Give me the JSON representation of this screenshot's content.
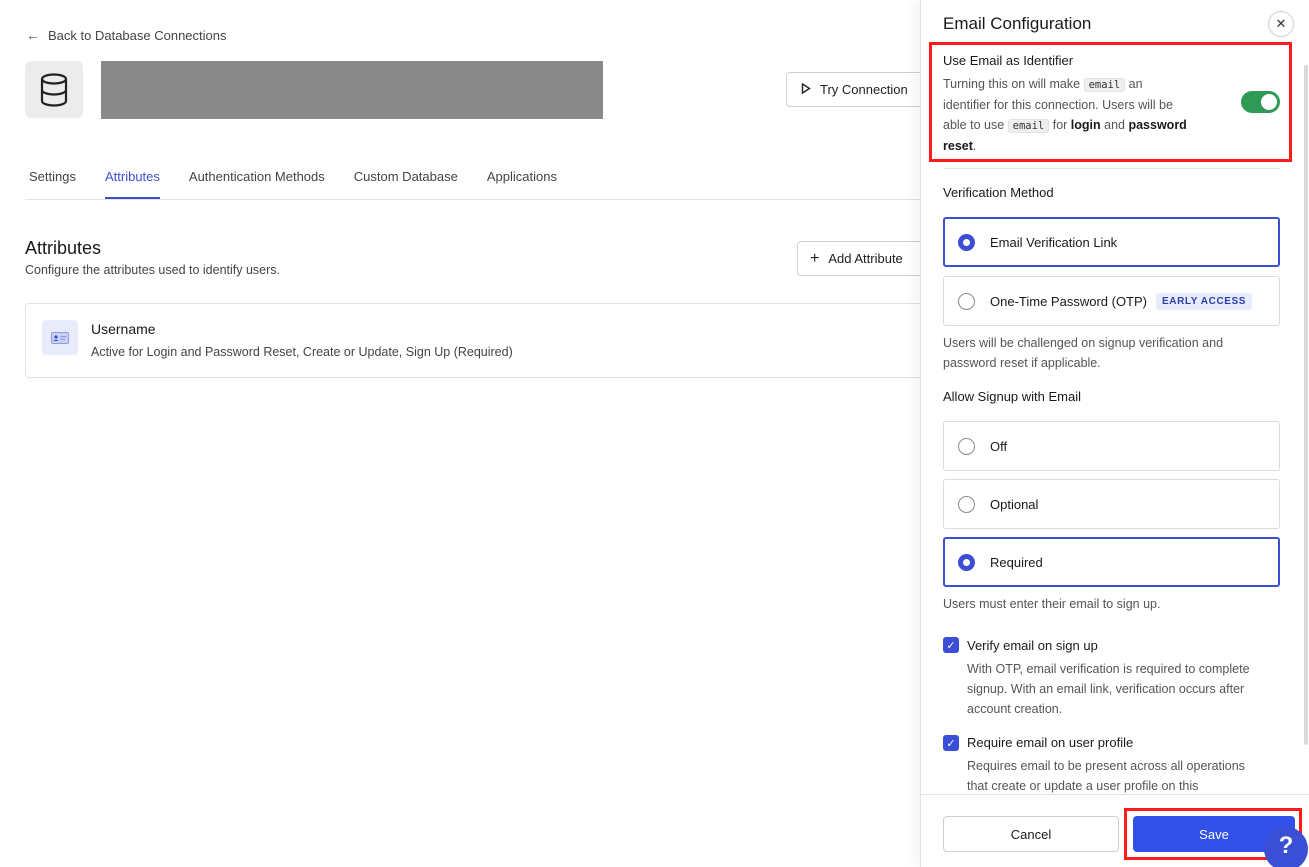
{
  "main": {
    "back_link": "Back to Database Connections",
    "try_connection": "Try Connection",
    "tabs": [
      {
        "label": "Settings"
      },
      {
        "label": "Attributes"
      },
      {
        "label": "Authentication Methods"
      },
      {
        "label": "Custom Database"
      },
      {
        "label": "Applications"
      }
    ],
    "active_tab": "Attributes",
    "attributes_title": "Attributes",
    "attributes_subtitle": "Configure the attributes used to identify users.",
    "add_attribute": "Add Attribute",
    "attribute_card": {
      "title": "Username",
      "description": "Active for Login and Password Reset, Create or Update, Sign Up (Required)"
    }
  },
  "panel": {
    "title": "Email Configuration",
    "close_icon": "close-icon",
    "email_identifier": {
      "title": "Use Email as Identifier",
      "desc_1": "Turning this on will make ",
      "code_1": "email",
      "desc_2": " an identifier for this connection. Users will be able to use ",
      "code_2": "email",
      "desc_3": " for ",
      "bold_1": "login",
      "desc_4": " and ",
      "bold_2": "password reset",
      "desc_5": ".",
      "enabled": true
    },
    "verification": {
      "label": "Verification Method",
      "options": [
        {
          "label": "Email Verification Link",
          "selected": true
        },
        {
          "label": "One-Time Password (OTP)",
          "badge": "EARLY ACCESS",
          "selected": false
        }
      ],
      "hint": "Users will be challenged on signup verification and password reset if applicable."
    },
    "signup": {
      "label": "Allow Signup with Email",
      "options": [
        {
          "label": "Off",
          "selected": false
        },
        {
          "label": "Optional",
          "selected": false
        },
        {
          "label": "Required",
          "selected": true
        }
      ],
      "hint": "Users must enter their email to sign up."
    },
    "checks": [
      {
        "label": "Verify email on sign up",
        "checked": true,
        "desc": "With OTP, email verification is required to complete signup. With an email link, verification occurs after account creation."
      },
      {
        "label": "Require email on user profile",
        "checked": true,
        "desc": "Requires email to be present across all operations that create or update a user profile on this"
      }
    ],
    "cancel": "Cancel",
    "save": "Save",
    "help": "?"
  },
  "colors": {
    "accent": "#3a4fd6",
    "toggle_on": "#2e9a55",
    "highlight": "#ff1a1a",
    "save": "#3150e8"
  }
}
